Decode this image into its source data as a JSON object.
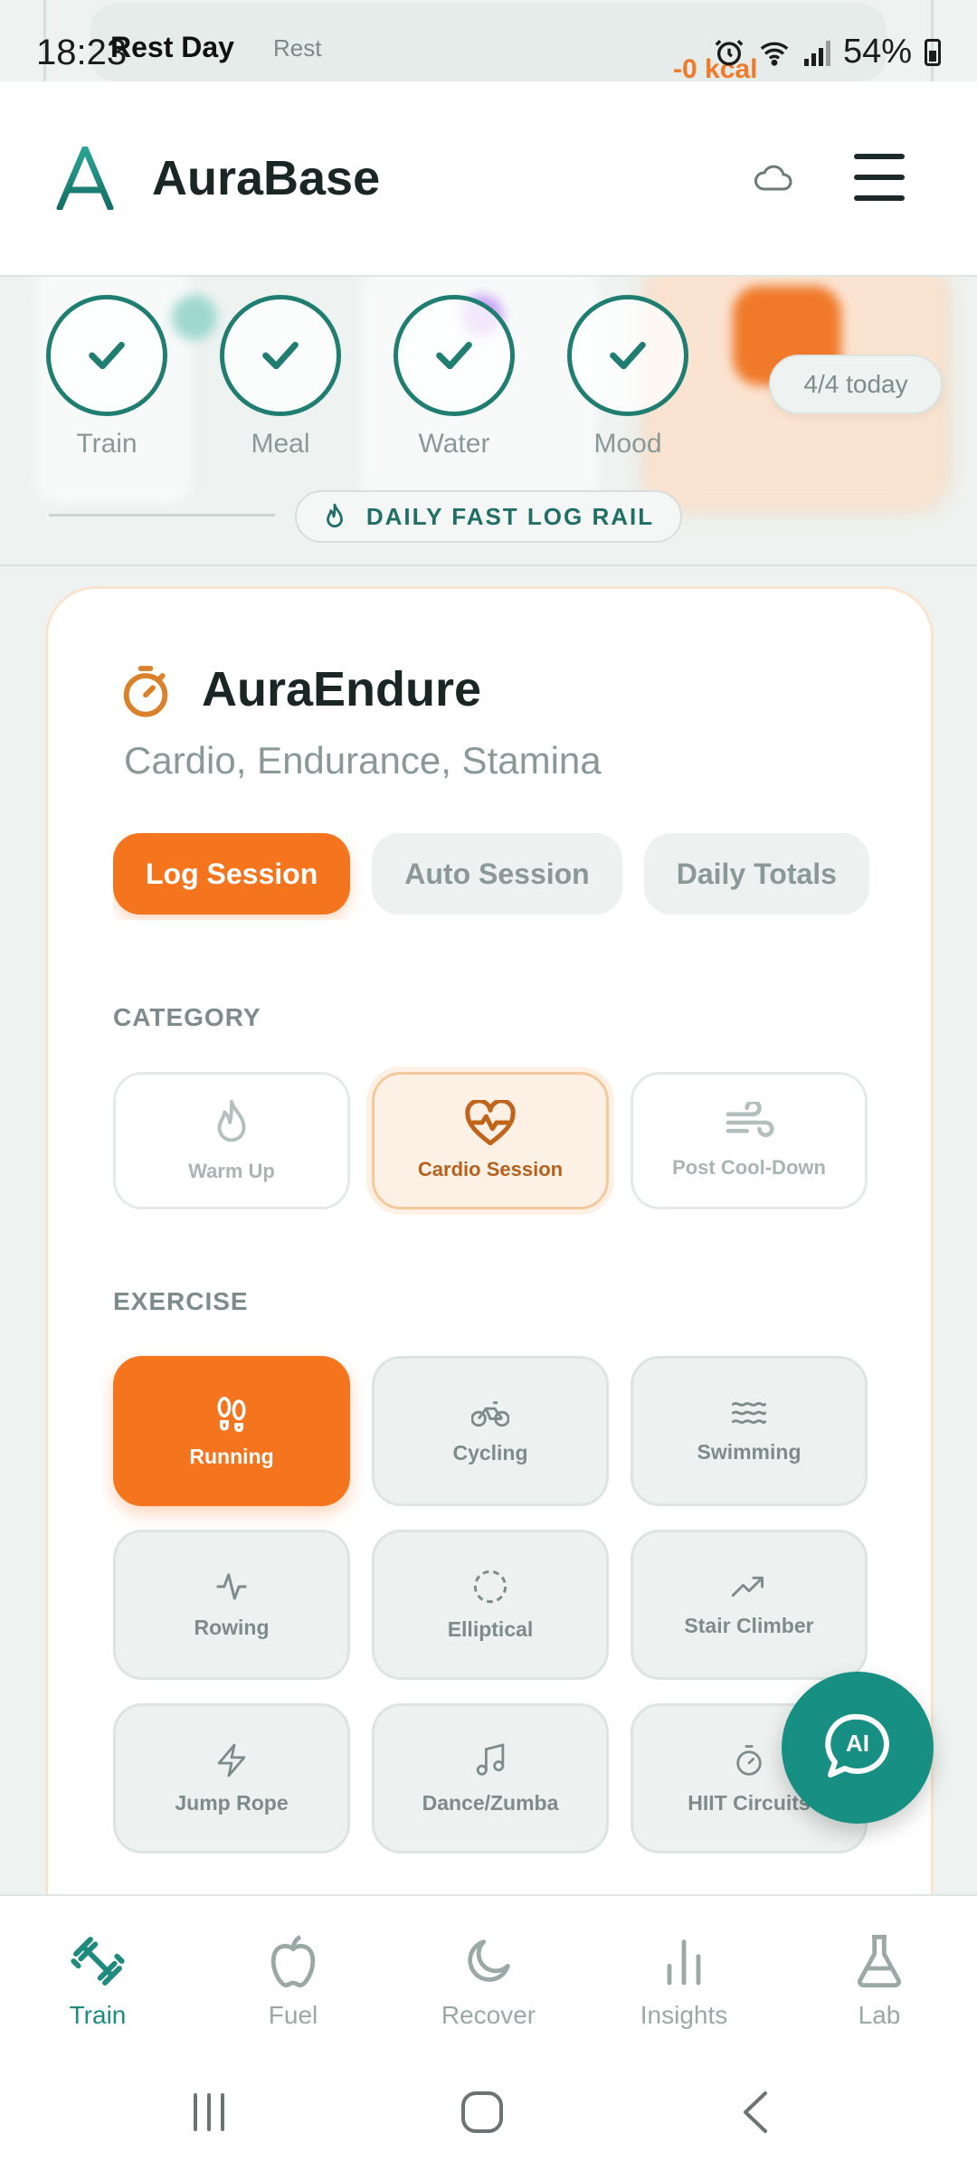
{
  "status_bar": {
    "time": "18:23",
    "overlay_title": "Rest Day",
    "overlay_sub": "Rest",
    "overlay_kcal": "-0 kcal",
    "battery": "54%"
  },
  "header": {
    "brand": "AuraBase"
  },
  "rail": {
    "checks": [
      {
        "label": "Train"
      },
      {
        "label": "Meal"
      },
      {
        "label": "Water"
      },
      {
        "label": "Mood"
      }
    ],
    "today_count": "4/4 today",
    "label": "DAILY FAST LOG RAIL"
  },
  "card": {
    "title": "AuraEndure",
    "subtitle": "Cardio, Endurance, Stamina",
    "tabs": [
      {
        "label": "Log Session",
        "active": true
      },
      {
        "label": "Auto Session"
      },
      {
        "label": "Daily Totals"
      }
    ],
    "category_heading": "CATEGORY",
    "categories": [
      {
        "label": "Warm Up",
        "icon": "flame-icon"
      },
      {
        "label": "Cardio Session",
        "icon": "heart-pulse-icon",
        "active": true
      },
      {
        "label": "Post Cool-Down",
        "icon": "wind-icon"
      }
    ],
    "exercise_heading": "EXERCISE",
    "exercises": [
      {
        "label": "Running",
        "icon": "footprints-icon",
        "active": true
      },
      {
        "label": "Cycling",
        "icon": "bike-icon"
      },
      {
        "label": "Swimming",
        "icon": "waves-icon"
      },
      {
        "label": "Rowing",
        "icon": "activity-icon"
      },
      {
        "label": "Elliptical",
        "icon": "dashed-circle-icon"
      },
      {
        "label": "Stair Climber",
        "icon": "trending-up-icon"
      },
      {
        "label": "Jump Rope",
        "icon": "zap-icon"
      },
      {
        "label": "Dance/Zumba",
        "icon": "music-icon"
      },
      {
        "label": "HIIT Circuits",
        "icon": "timer-icon"
      }
    ]
  },
  "fab": {
    "label": "AI"
  },
  "bottom_nav": [
    {
      "label": "Train",
      "active": true
    },
    {
      "label": "Fuel"
    },
    {
      "label": "Recover"
    },
    {
      "label": "Insights"
    },
    {
      "label": "Lab"
    }
  ],
  "colors": {
    "accent_teal": "#1f8a7e",
    "accent_orange": "#f5751e",
    "background": "#eef3f1"
  }
}
